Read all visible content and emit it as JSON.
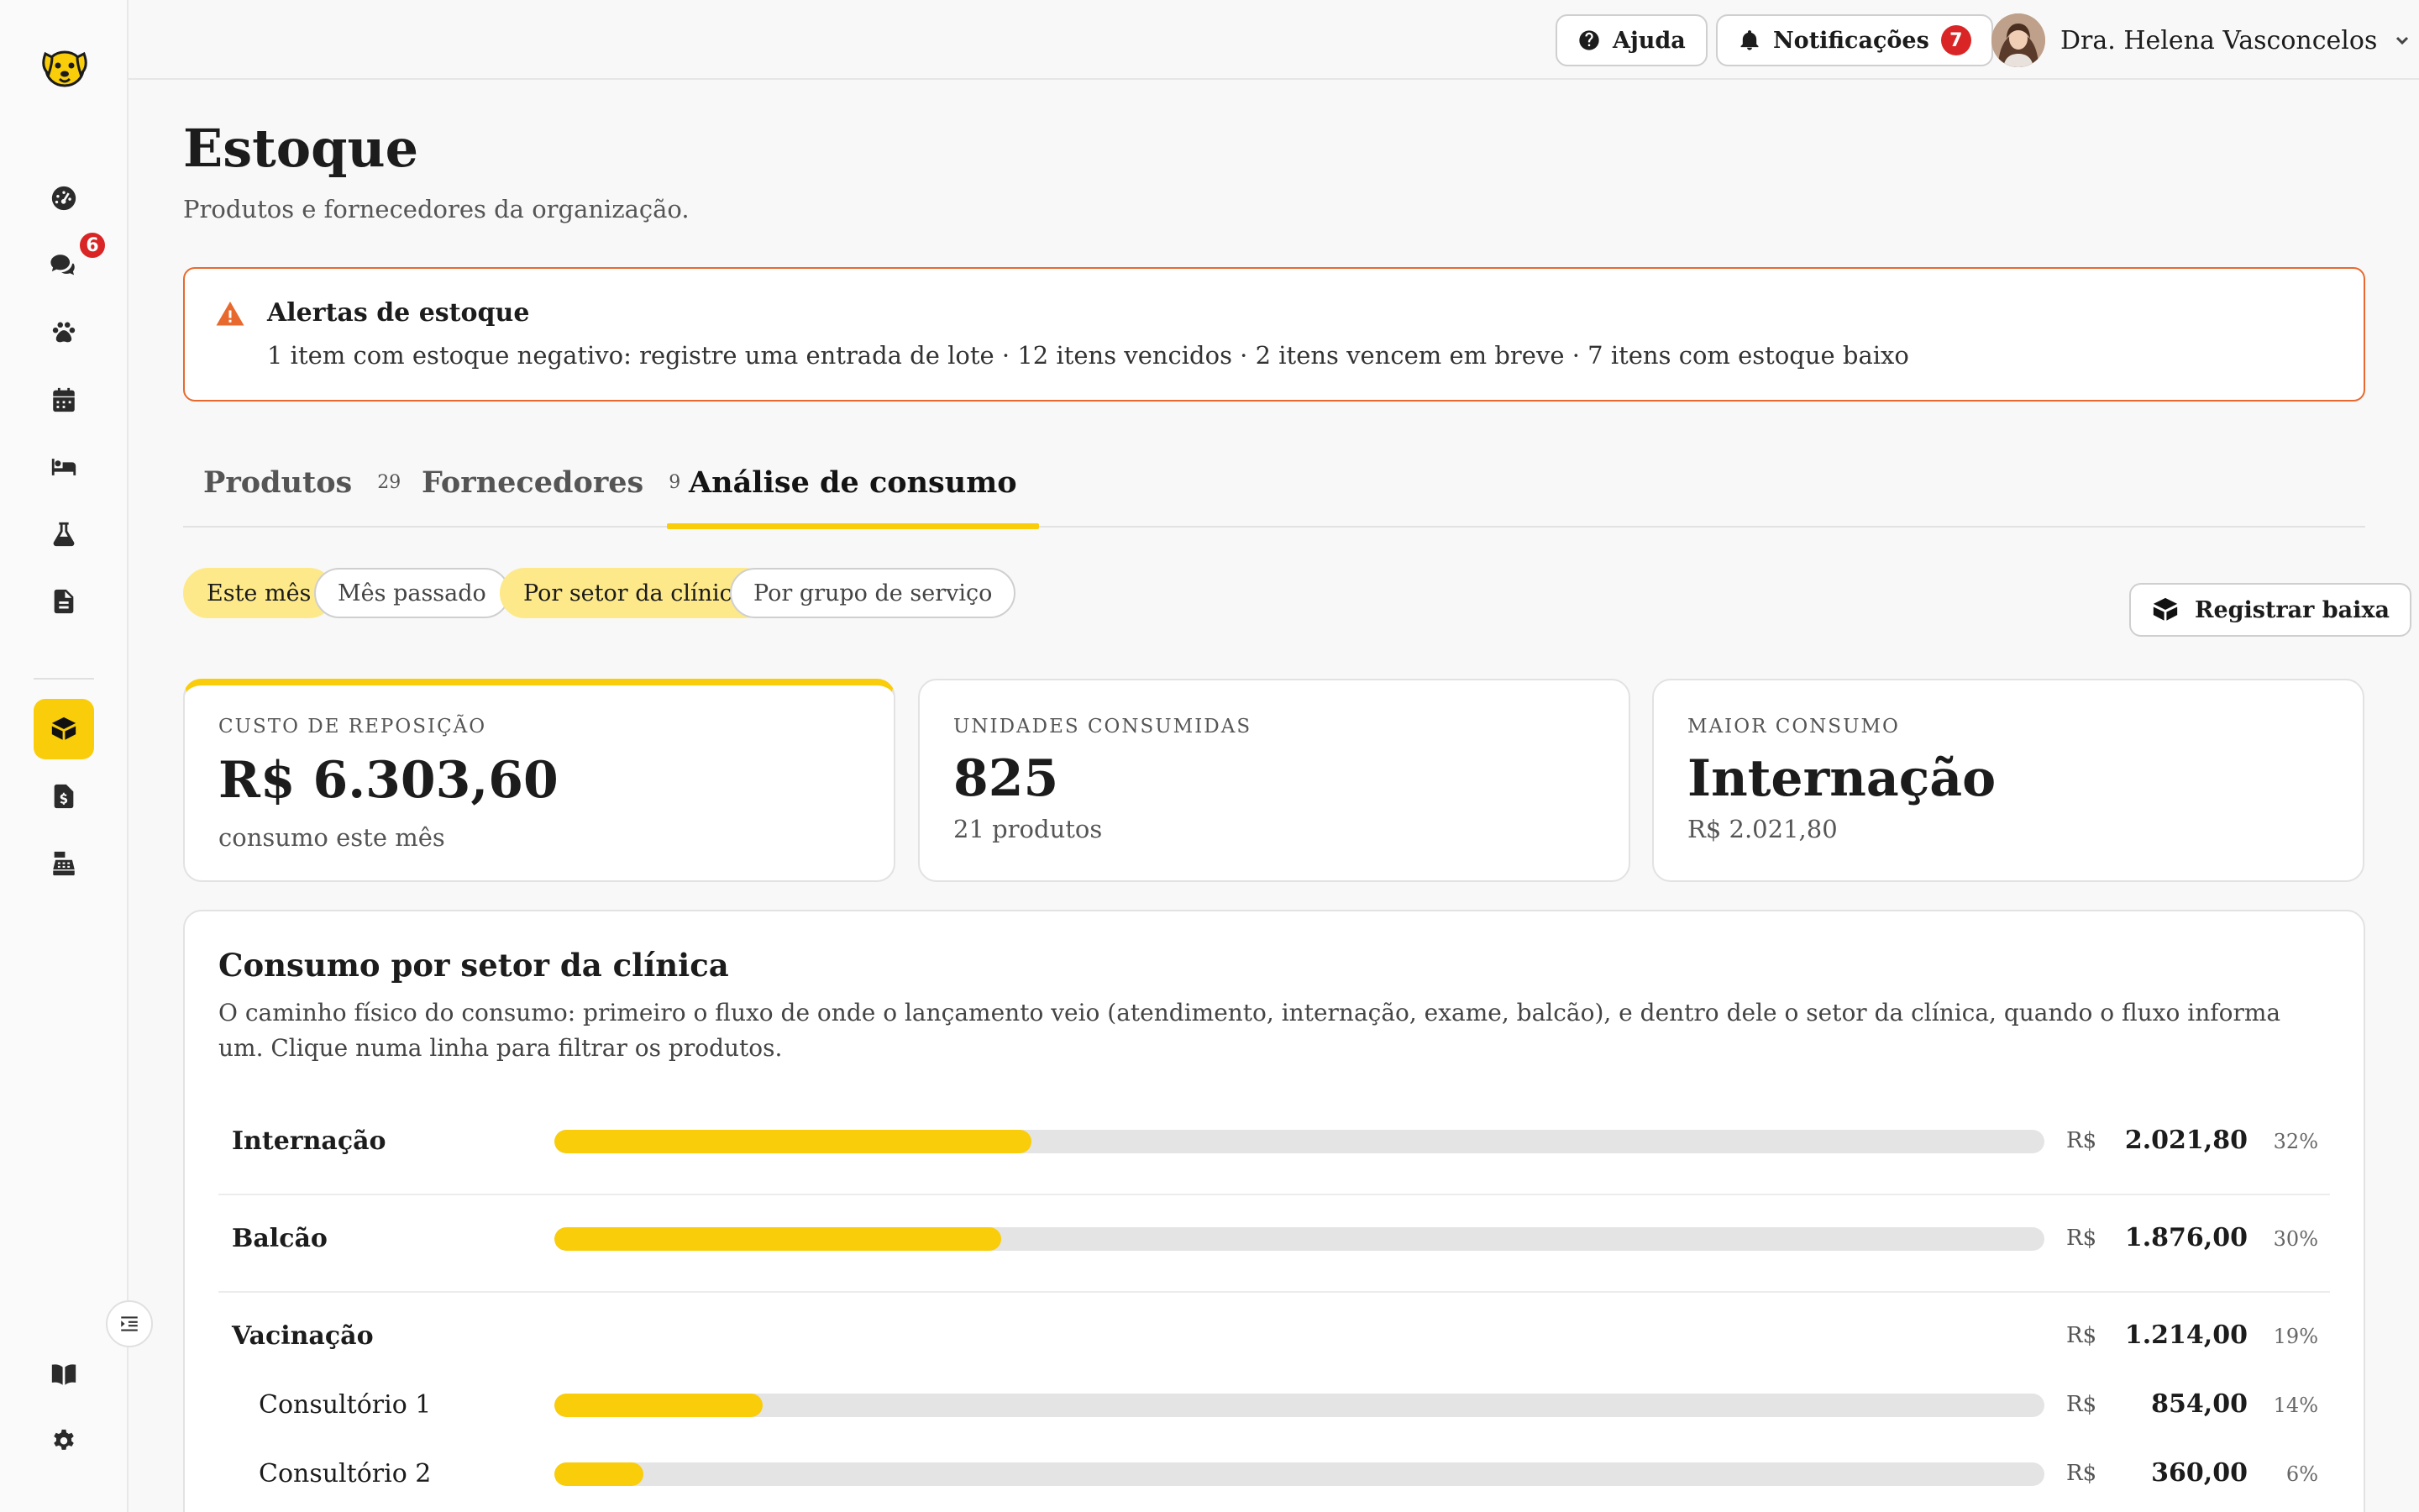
{
  "sidebar": {
    "messages_badge": "6"
  },
  "topbar": {
    "help_label": "Ajuda",
    "notifications_label": "Notificações",
    "notifications_count": "7",
    "user_name": "Dra. Helena Vasconcelos"
  },
  "page": {
    "title": "Estoque",
    "subtitle": "Produtos e fornecedores da organização."
  },
  "alert": {
    "title": "Alertas de estoque",
    "text": "1 item com estoque negativo: registre uma entrada de lote · 12 itens vencidos · 2 itens vencem em breve · 7 itens com estoque baixo",
    "color": "#e8692e"
  },
  "tabs": [
    {
      "label": "Produtos",
      "count": "29"
    },
    {
      "label": "Fornecedores",
      "count": "9"
    },
    {
      "label": "Análise de consumo",
      "count": ""
    }
  ],
  "filters": {
    "period": [
      "Este mês",
      "Mês passado"
    ],
    "grouping": [
      "Por setor da clínica",
      "Por grupo de serviço"
    ]
  },
  "register_button": "Registrar baixa",
  "cards": [
    {
      "label": "CUSTO DE REPOSIÇÃO",
      "value": "R$ 6.303,60",
      "sub": "consumo este mês"
    },
    {
      "label": "UNIDADES CONSUMIDAS",
      "value": "825",
      "sub": "21 produtos"
    },
    {
      "label": "MAIOR CONSUMO",
      "value": "Internação",
      "sub": "R$ 2.021,80"
    }
  ],
  "panel": {
    "title": "Consumo por setor da clínica",
    "description": "O caminho físico do consumo: primeiro o fluxo de onde o lançamento veio (atendimento, internação, exame, balcão), e dentro dele o setor da clínica, quando o fluxo informa um. Clique numa linha para filtrar os produtos.",
    "currency": "R$",
    "rows": [
      {
        "label": "Internação",
        "amount": "2.021,80",
        "pct": "32%",
        "share": 0.32
      },
      {
        "label": "Balcão",
        "amount": "1.876,00",
        "pct": "30%",
        "share": 0.3
      },
      {
        "label": "Vacinação",
        "amount": "1.214,00",
        "pct": "19%"
      },
      {
        "label": "Consultório 1",
        "amount": "854,00",
        "pct": "14%",
        "share": 0.14
      },
      {
        "label": "Consultório 2",
        "amount": "360,00",
        "pct": "6%",
        "share": 0.06
      }
    ]
  },
  "colors": {
    "accent": "#f9cd0a",
    "badge": "#d92525"
  }
}
